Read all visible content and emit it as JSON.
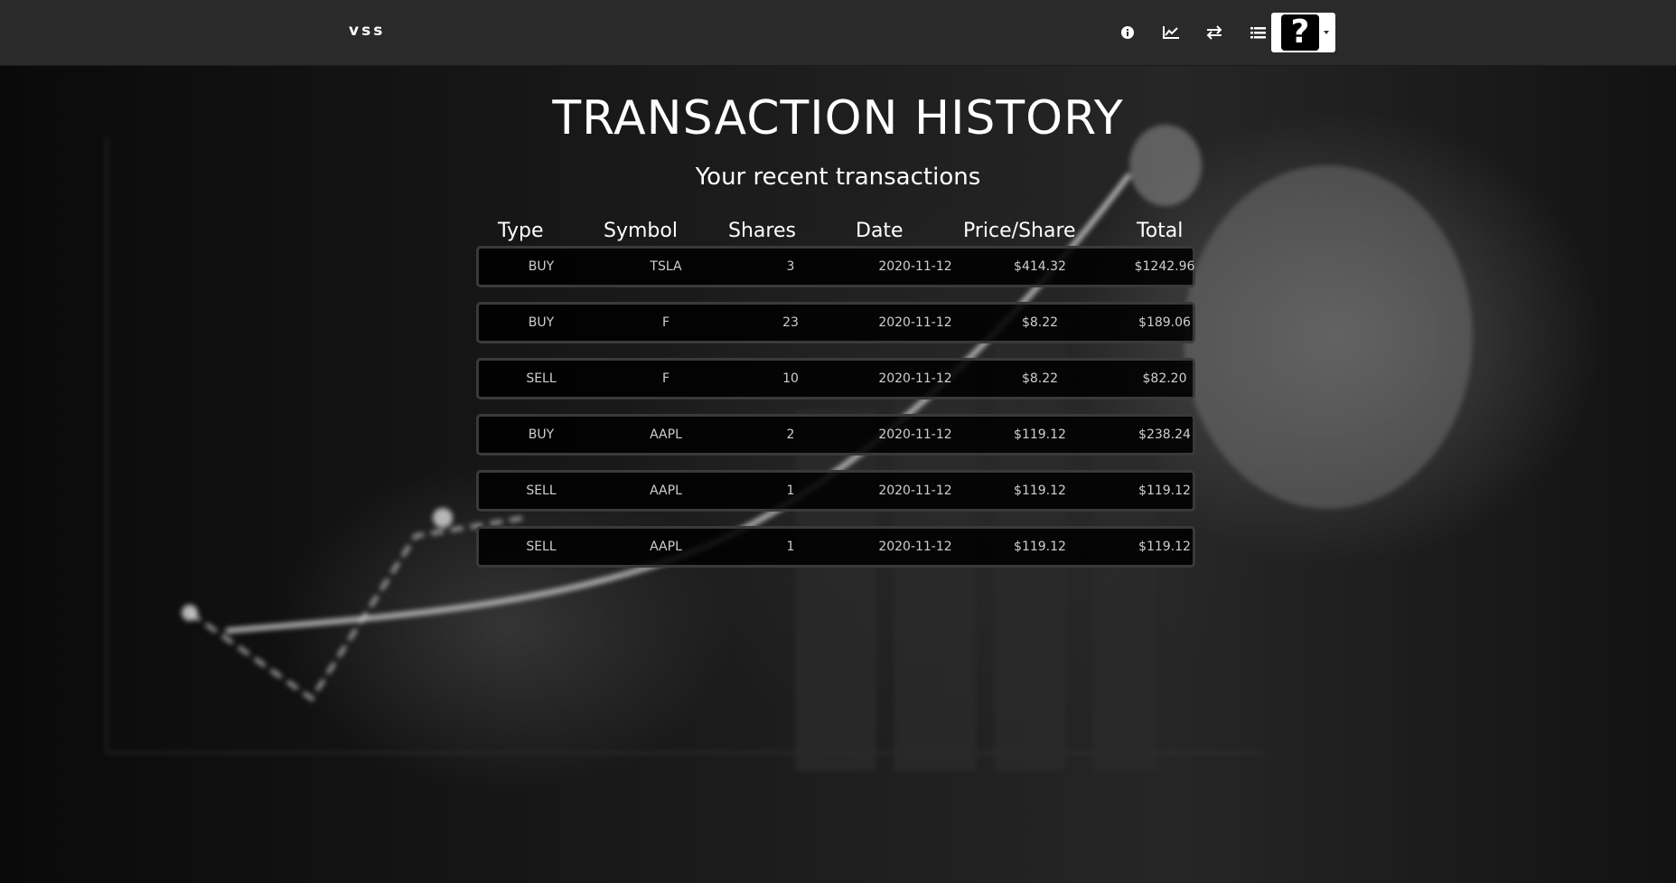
{
  "nav": {
    "brand": "vss",
    "icons": [
      "info-icon",
      "chart-line-icon",
      "exchange-icon",
      "list-icon"
    ],
    "user_avatar_glyph": "?"
  },
  "page": {
    "title": "TRANSACTION HISTORY",
    "subtitle": "Your recent transactions"
  },
  "table": {
    "columns": [
      "Type",
      "Symbol",
      "Shares",
      "Date",
      "Price/Share",
      "Total"
    ],
    "rows": [
      [
        "BUY",
        "TSLA",
        "3",
        "2020-11-12",
        "$414.32",
        "$1242.96"
      ],
      [
        "BUY",
        "F",
        "23",
        "2020-11-12",
        "$8.22",
        "$189.06"
      ],
      [
        "SELL",
        "F",
        "10",
        "2020-11-12",
        "$8.22",
        "$82.20"
      ],
      [
        "BUY",
        "AAPL",
        "2",
        "2020-11-12",
        "$119.12",
        "$238.24"
      ],
      [
        "SELL",
        "AAPL",
        "1",
        "2020-11-12",
        "$119.12",
        "$119.12"
      ],
      [
        "SELL",
        "AAPL",
        "1",
        "2020-11-12",
        "$119.12",
        "$119.12"
      ]
    ]
  },
  "colors": {
    "navbar": "#2a2a2a",
    "row_border": "#3a3a3a",
    "row_bg": "#000000",
    "text": "#ffffff"
  }
}
